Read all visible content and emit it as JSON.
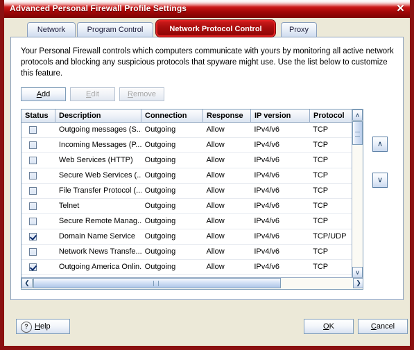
{
  "window": {
    "title": "Advanced Personal Firewall Profile Settings",
    "close_label": "✕",
    "accent_color": "#a70d0d",
    "border_color": "#8a1010"
  },
  "tabs": [
    {
      "label": "Network",
      "selected": false
    },
    {
      "label": "Program Control",
      "selected": false
    },
    {
      "label": "Network Protocol Control",
      "selected": true
    },
    {
      "label": "Proxy",
      "selected": false
    }
  ],
  "panel": {
    "description": "Your Personal Firewall controls which computers communicate with yours by monitoring all active network protocols and blocking any suspicious protocols that spyware might use. Use the list below to customize this feature."
  },
  "toolbar": {
    "add_label": "Add",
    "add_accel": "A",
    "edit_label": "Edit",
    "edit_accel": "E",
    "remove_label": "Remove",
    "remove_accel": "R"
  },
  "grid": {
    "columns": [
      "Status",
      "Description",
      "Connection",
      "Response",
      "IP version",
      "Protocol"
    ],
    "rows": [
      {
        "checked": false,
        "description": "Outgoing messages (S...",
        "connection": "Outgoing",
        "response": "Allow",
        "ip_version": "IPv4/v6",
        "protocol": "TCP"
      },
      {
        "checked": false,
        "description": "Incoming Messages (P...",
        "connection": "Outgoing",
        "response": "Allow",
        "ip_version": "IPv4/v6",
        "protocol": "TCP"
      },
      {
        "checked": false,
        "description": "Web Services (HTTP)",
        "connection": "Outgoing",
        "response": "Allow",
        "ip_version": "IPv4/v6",
        "protocol": "TCP"
      },
      {
        "checked": false,
        "description": "Secure Web Services (...",
        "connection": "Outgoing",
        "response": "Allow",
        "ip_version": "IPv4/v6",
        "protocol": "TCP"
      },
      {
        "checked": false,
        "description": "File Transfer Protocol (...",
        "connection": "Outgoing",
        "response": "Allow",
        "ip_version": "IPv4/v6",
        "protocol": "TCP"
      },
      {
        "checked": false,
        "description": "Telnet",
        "connection": "Outgoing",
        "response": "Allow",
        "ip_version": "IPv4/v6",
        "protocol": "TCP"
      },
      {
        "checked": false,
        "description": "Secure Remote Manag...",
        "connection": "Outgoing",
        "response": "Allow",
        "ip_version": "IPv4/v6",
        "protocol": "TCP"
      },
      {
        "checked": true,
        "description": "Domain Name Service",
        "connection": "Outgoing",
        "response": "Allow",
        "ip_version": "IPv4/v6",
        "protocol": "TCP/UDP"
      },
      {
        "checked": false,
        "description": "Network News Transfe...",
        "connection": "Outgoing",
        "response": "Allow",
        "ip_version": "IPv4/v6",
        "protocol": "TCP"
      },
      {
        "checked": true,
        "description": "Outgoing America Onlin...",
        "connection": "Outgoing",
        "response": "Allow",
        "ip_version": "IPv4/v6",
        "protocol": "TCP"
      }
    ]
  },
  "scrollbars": {
    "up_arrow": "∧",
    "down_arrow": "∨",
    "left_arrow": "❮",
    "right_arrow": "❯"
  },
  "reorder": {
    "move_up": "∧",
    "move_down": "∨"
  },
  "footer": {
    "help_label": "Help",
    "help_accel": "H",
    "help_icon": "?",
    "ok_label": "OK",
    "ok_accel": "O",
    "cancel_label": "Cancel",
    "cancel_accel": "C"
  }
}
